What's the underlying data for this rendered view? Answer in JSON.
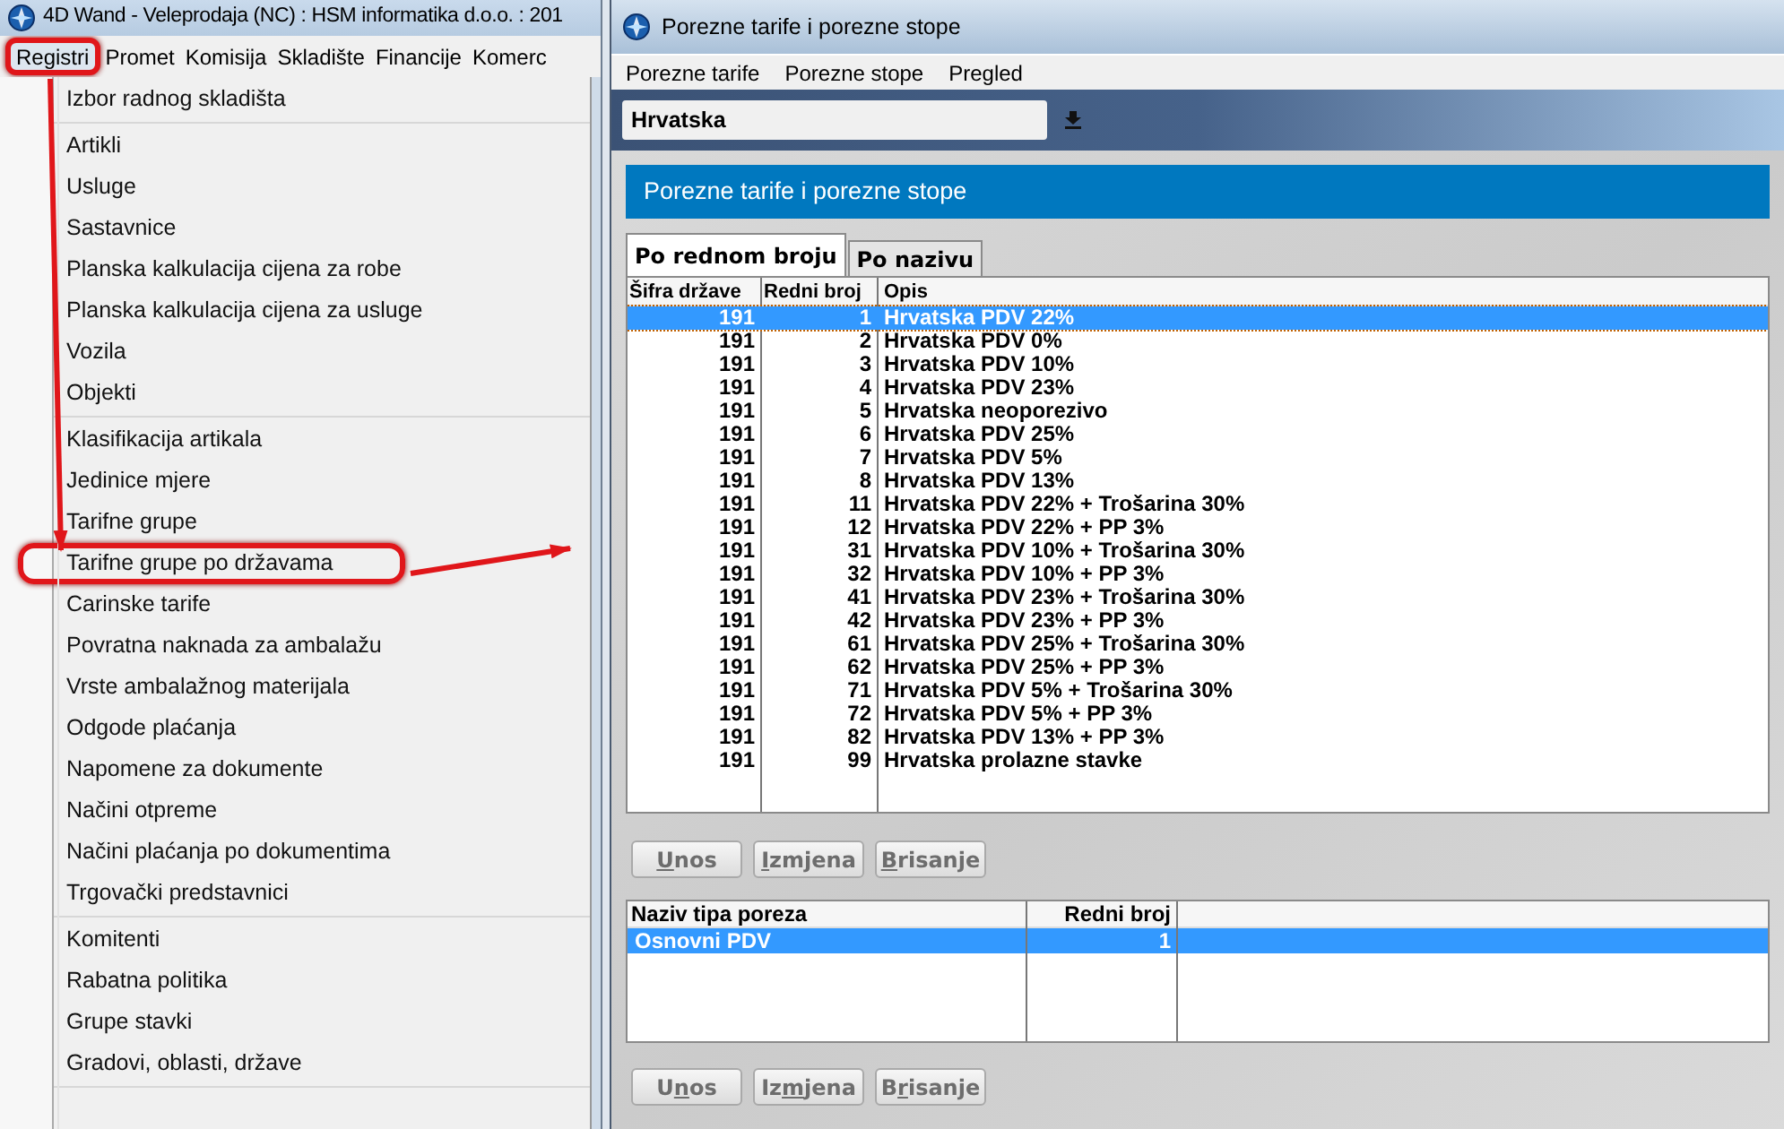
{
  "main_window": {
    "title": "4D Wand - Veleprodaja (NC) : HSM informatika d.o.o. : 201",
    "menu": [
      {
        "label": "Registri",
        "highlighted": true
      },
      {
        "label": "Promet",
        "highlighted": false
      },
      {
        "label": "Komisija",
        "highlighted": false
      },
      {
        "label": "Skladište",
        "highlighted": false
      },
      {
        "label": "Financije",
        "highlighted": false
      },
      {
        "label": "Komerc",
        "highlighted": false
      }
    ],
    "dropdown": [
      [
        {
          "label": "Izbor radnog skladišta",
          "highlighted": false
        }
      ],
      [
        {
          "label": "Artikli",
          "highlighted": false
        },
        {
          "label": "Usluge",
          "highlighted": false
        },
        {
          "label": "Sastavnice",
          "highlighted": false
        },
        {
          "label": "Planska kalkulacija cijena za robe",
          "highlighted": false
        },
        {
          "label": "Planska kalkulacija cijena za usluge",
          "highlighted": false
        },
        {
          "label": "Vozila",
          "highlighted": false
        },
        {
          "label": "Objekti",
          "highlighted": false
        }
      ],
      [
        {
          "label": "Klasifikacija artikala",
          "highlighted": false
        },
        {
          "label": "Jedinice mjere",
          "highlighted": false
        },
        {
          "label": "Tarifne grupe",
          "highlighted": false
        },
        {
          "label": "Tarifne grupe po državama",
          "highlighted": true
        },
        {
          "label": "Carinske tarife",
          "highlighted": false
        },
        {
          "label": "Povratna naknada za ambalažu",
          "highlighted": false
        },
        {
          "label": "Vrste ambalažnog materijala",
          "highlighted": false
        },
        {
          "label": "Odgode plaćanja",
          "highlighted": false
        },
        {
          "label": "Napomene za dokumente",
          "highlighted": false
        },
        {
          "label": "Načini otpreme",
          "highlighted": false
        },
        {
          "label": "Načini plaćanja po dokumentima",
          "highlighted": false
        },
        {
          "label": "Trgovački predstavnici",
          "highlighted": false
        }
      ],
      [
        {
          "label": "Komitenti",
          "highlighted": false
        },
        {
          "label": "Rabatna politika",
          "highlighted": false
        },
        {
          "label": "Grupe stavki",
          "highlighted": false
        },
        {
          "label": "Gradovi, oblasti, države",
          "highlighted": false
        }
      ]
    ]
  },
  "tax_window": {
    "title": "Porezne tarife i porezne stope",
    "menu": [
      "Porezne tarife",
      "Porezne stope",
      "Pregled"
    ],
    "country_field": {
      "value": "Hrvatska"
    },
    "header": "Porezne tarife i porezne stope",
    "tabs": [
      {
        "label": "Po rednom broju",
        "selected": true
      },
      {
        "label": "Po nazivu",
        "selected": false
      }
    ],
    "rates_table": {
      "columns": [
        "Šifra države",
        "Redni broj",
        "Opis"
      ],
      "rows": [
        {
          "cells": [
            "191",
            "1",
            "Hrvatska PDV 22%"
          ],
          "selected": true
        },
        {
          "cells": [
            "191",
            "2",
            "Hrvatska PDV 0%"
          ],
          "selected": false
        },
        {
          "cells": [
            "191",
            "3",
            "Hrvatska PDV 10%"
          ],
          "selected": false
        },
        {
          "cells": [
            "191",
            "4",
            "Hrvatska PDV 23%"
          ],
          "selected": false
        },
        {
          "cells": [
            "191",
            "5",
            "Hrvatska neoporezivo"
          ],
          "selected": false
        },
        {
          "cells": [
            "191",
            "6",
            "Hrvatska PDV 25%"
          ],
          "selected": false
        },
        {
          "cells": [
            "191",
            "7",
            "Hrvatska PDV 5%"
          ],
          "selected": false
        },
        {
          "cells": [
            "191",
            "8",
            "Hrvatska PDV 13%"
          ],
          "selected": false
        },
        {
          "cells": [
            "191",
            "11",
            "Hrvatska PDV 22% + Trošarina 30%"
          ],
          "selected": false
        },
        {
          "cells": [
            "191",
            "12",
            "Hrvatska PDV 22% + PP 3%"
          ],
          "selected": false
        },
        {
          "cells": [
            "191",
            "31",
            "Hrvatska PDV 10% + Trošarina 30%"
          ],
          "selected": false
        },
        {
          "cells": [
            "191",
            "32",
            "Hrvatska PDV 10% + PP 3%"
          ],
          "selected": false
        },
        {
          "cells": [
            "191",
            "41",
            "Hrvatska PDV 23% + Trošarina 30%"
          ],
          "selected": false
        },
        {
          "cells": [
            "191",
            "42",
            "Hrvatska PDV 23% + PP 3%"
          ],
          "selected": false
        },
        {
          "cells": [
            "191",
            "61",
            "Hrvatska PDV 25% + Trošarina 30%"
          ],
          "selected": false
        },
        {
          "cells": [
            "191",
            "62",
            "Hrvatska PDV 25% + PP 3%"
          ],
          "selected": false
        },
        {
          "cells": [
            "191",
            "71",
            "Hrvatska PDV 5% + Trošarina 30%"
          ],
          "selected": false
        },
        {
          "cells": [
            "191",
            "72",
            "Hrvatska PDV 5% + PP 3%"
          ],
          "selected": false
        },
        {
          "cells": [
            "191",
            "82",
            "Hrvatska PDV 13% + PP 3%"
          ],
          "selected": false
        },
        {
          "cells": [
            "191",
            "99",
            "Hrvatska prolazne stavke"
          ],
          "selected": false
        }
      ]
    },
    "rates_buttons": [
      {
        "key": "U",
        "after": "nos"
      },
      {
        "key": "I",
        "after": "zmjena"
      },
      {
        "key": "B",
        "after": "risanje"
      }
    ],
    "types_table": {
      "columns": [
        "Naziv tipa poreza",
        "Redni broj"
      ],
      "rows": [
        {
          "cells": [
            "Osnovni PDV",
            "1"
          ],
          "selected": true
        }
      ]
    },
    "types_buttons": [
      {
        "before": "U",
        "key": "n",
        "after": "os"
      },
      {
        "before": "Iz",
        "key": "m",
        "after": "jena"
      },
      {
        "before": "B",
        "key": "r",
        "after": "isanje"
      }
    ]
  }
}
